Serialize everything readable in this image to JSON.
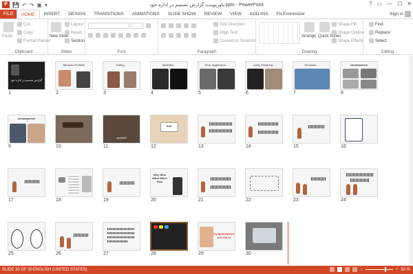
{
  "window": {
    "title": "پاورپوینت گزارش تصمیم در اداره خود.pptx - PowerPoint",
    "app_icon_letter": "P",
    "controls": [
      "?",
      "▭",
      "—",
      "☐",
      "✕"
    ]
  },
  "qat": [
    "💾",
    "↶",
    "↷",
    "▣",
    "▾"
  ],
  "tabs": {
    "file": "FILE",
    "items": [
      "HOME",
      "INSERT",
      "DESIGN",
      "TRANSITIONS",
      "ANIMATIONS",
      "SLIDE SHOW",
      "REVIEW",
      "VIEW",
      "ADD-INS",
      "FILEminimizer"
    ],
    "active": "HOME",
    "signin": "Sign in"
  },
  "ribbon": {
    "clipboard": {
      "label": "Clipboard",
      "paste": "Paste",
      "cut": "Cut",
      "copy": "Copy",
      "format_painter": "Format Painter"
    },
    "slides": {
      "label": "Slides",
      "new_slide": "New Slide",
      "layout": "Layout",
      "reset": "Reset",
      "section": "Section"
    },
    "font": {
      "label": "Font"
    },
    "paragraph": {
      "label": "Paragraph",
      "text_direction": "Text Direction",
      "align_text": "Align Text",
      "convert": "Convert to SmartArt"
    },
    "drawing": {
      "label": "Drawing",
      "arrange": "Arrange",
      "quick_styles": "Quick Styles",
      "shape_fill": "Shape Fill",
      "shape_outline": "Shape Outline",
      "shape_effects": "Shape Effects"
    },
    "editing": {
      "label": "Editing",
      "find": "Find",
      "replace": "Replace",
      "select": "Select"
    }
  },
  "slides": [
    {
      "n": "1",
      "title": "گزارش تصمیم در اداره خود"
    },
    {
      "n": "2",
      "title": "Behavior Problem"
    },
    {
      "n": "3",
      "title": "Eating..."
    },
    {
      "n": "4",
      "title": "Addiction..."
    },
    {
      "n": "5",
      "title": "Fear, Aggression..."
    },
    {
      "n": "6",
      "title": "Lying, Swearing..."
    },
    {
      "n": "7",
      "title": "Emotions..."
    },
    {
      "n": "8",
      "title": "consequence"
    },
    {
      "n": "9",
      "title": "consequence"
    },
    {
      "n": "10",
      "title": ""
    },
    {
      "n": "11",
      "title": "yourself"
    },
    {
      "n": "12",
      "title": "Self"
    },
    {
      "n": "13",
      "title": ""
    },
    {
      "n": "14",
      "title": ""
    },
    {
      "n": "15",
      "title": ""
    },
    {
      "n": "16",
      "title": ""
    },
    {
      "n": "17",
      "title": ""
    },
    {
      "n": "18",
      "title": ""
    },
    {
      "n": "19",
      "title": ""
    },
    {
      "n": "20",
      "title": "Why Who What When How"
    },
    {
      "n": "21",
      "title": ""
    },
    {
      "n": "22",
      "title": ""
    },
    {
      "n": "23",
      "title": ""
    },
    {
      "n": "24",
      "title": ""
    },
    {
      "n": "25",
      "title": ""
    },
    {
      "n": "26",
      "title": ""
    },
    {
      "n": "27",
      "title": ""
    },
    {
      "n": "28",
      "title": ""
    },
    {
      "n": "29",
      "title": "Congratulations you did it!"
    },
    {
      "n": "30",
      "title": ""
    }
  ],
  "status": {
    "slide": "SLIDE 30 OF 30",
    "language": "ENGLISH (UNITED STATES)",
    "zoom": "50 %"
  },
  "colors": {
    "accent": "#d24726"
  }
}
